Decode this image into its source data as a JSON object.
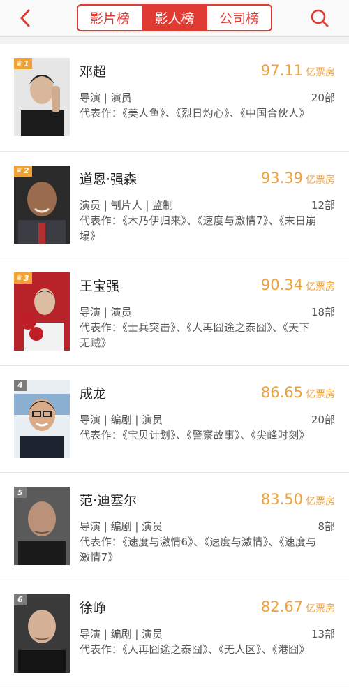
{
  "header": {
    "tabs": [
      {
        "label": "影片榜",
        "active": false
      },
      {
        "label": "影人榜",
        "active": true
      },
      {
        "label": "公司榜",
        "active": false
      }
    ],
    "accent_color": "#df3b33"
  },
  "box_unit": "亿票房",
  "items": [
    {
      "rank": "1",
      "name": "邓超",
      "box": "97.11",
      "roles": "导演 | 演员",
      "count": "20部",
      "works": "代表作：《美人鱼》、《烈日灼心》、《中国合伙人》"
    },
    {
      "rank": "2",
      "name": "道恩·强森",
      "box": "93.39",
      "roles": "演员 | 制片人 | 监制",
      "count": "12部",
      "works": "代表作：《木乃伊归来》、《速度与激情7》、《末日崩塌》"
    },
    {
      "rank": "3",
      "name": "王宝强",
      "box": "90.34",
      "roles": "导演 | 演员",
      "count": "18部",
      "works": "代表作：《士兵突击》、《人再囧途之泰囧》、《天下无贼》"
    },
    {
      "rank": "4",
      "name": "成龙",
      "box": "86.65",
      "roles": "导演 | 编剧 | 演员",
      "count": "20部",
      "works": "代表作：《宝贝计划》、《警察故事》、《尖峰时刻》"
    },
    {
      "rank": "5",
      "name": "范·迪塞尔",
      "box": "83.50",
      "roles": "导演 | 编剧 | 演员",
      "count": "8部",
      "works": "代表作：《速度与激情6》、《速度与激情》、《速度与激情7》"
    },
    {
      "rank": "6",
      "name": "徐峥",
      "box": "82.67",
      "roles": "导演 | 编剧 | 演员",
      "count": "13部",
      "works": "代表作：《人再囧途之泰囧》、《无人区》、《港囧》"
    }
  ]
}
